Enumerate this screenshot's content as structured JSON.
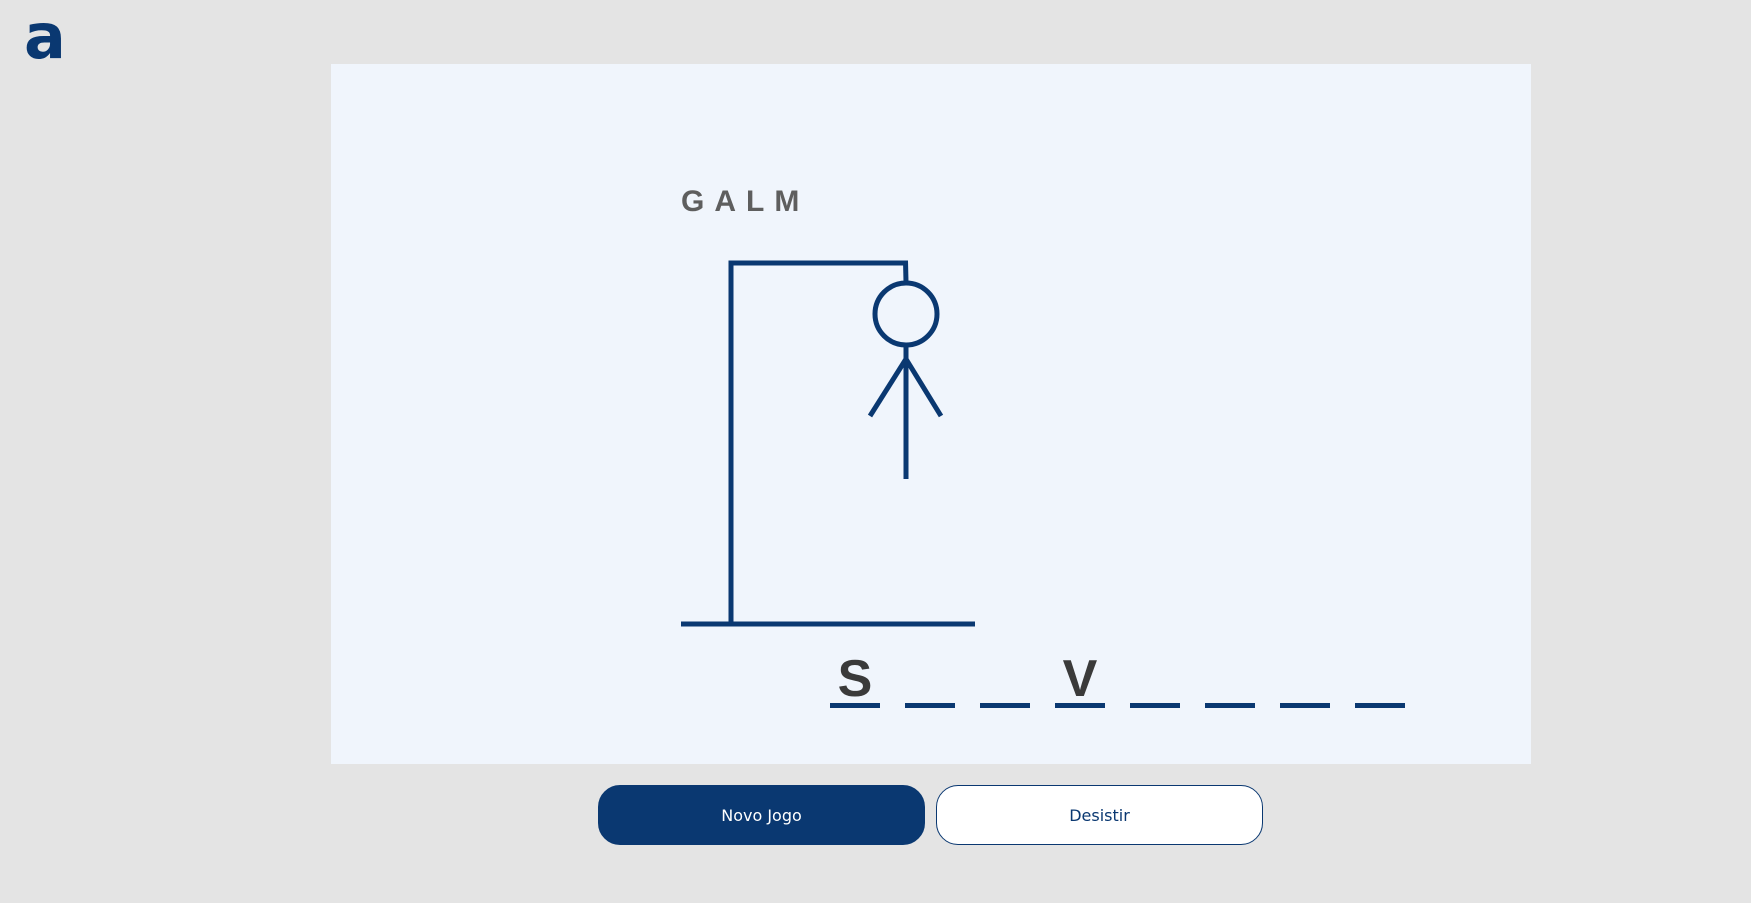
{
  "logo": {
    "text": "a",
    "color": "#0a3871"
  },
  "game": {
    "wrong_letters": "GALM",
    "errors": 7,
    "word_slots": [
      {
        "letter": "S"
      },
      {
        "letter": ""
      },
      {
        "letter": ""
      },
      {
        "letter": "V"
      },
      {
        "letter": ""
      },
      {
        "letter": ""
      },
      {
        "letter": ""
      },
      {
        "letter": ""
      }
    ]
  },
  "buttons": {
    "new_game": "Novo Jogo",
    "give_up": "Desistir"
  },
  "colors": {
    "primary": "#0a3871",
    "board_bg": "#f0f5fc",
    "page_bg": "#e4e4e4",
    "wrong_letters": "#5e5e5e",
    "letters": "#3a3a3a"
  }
}
